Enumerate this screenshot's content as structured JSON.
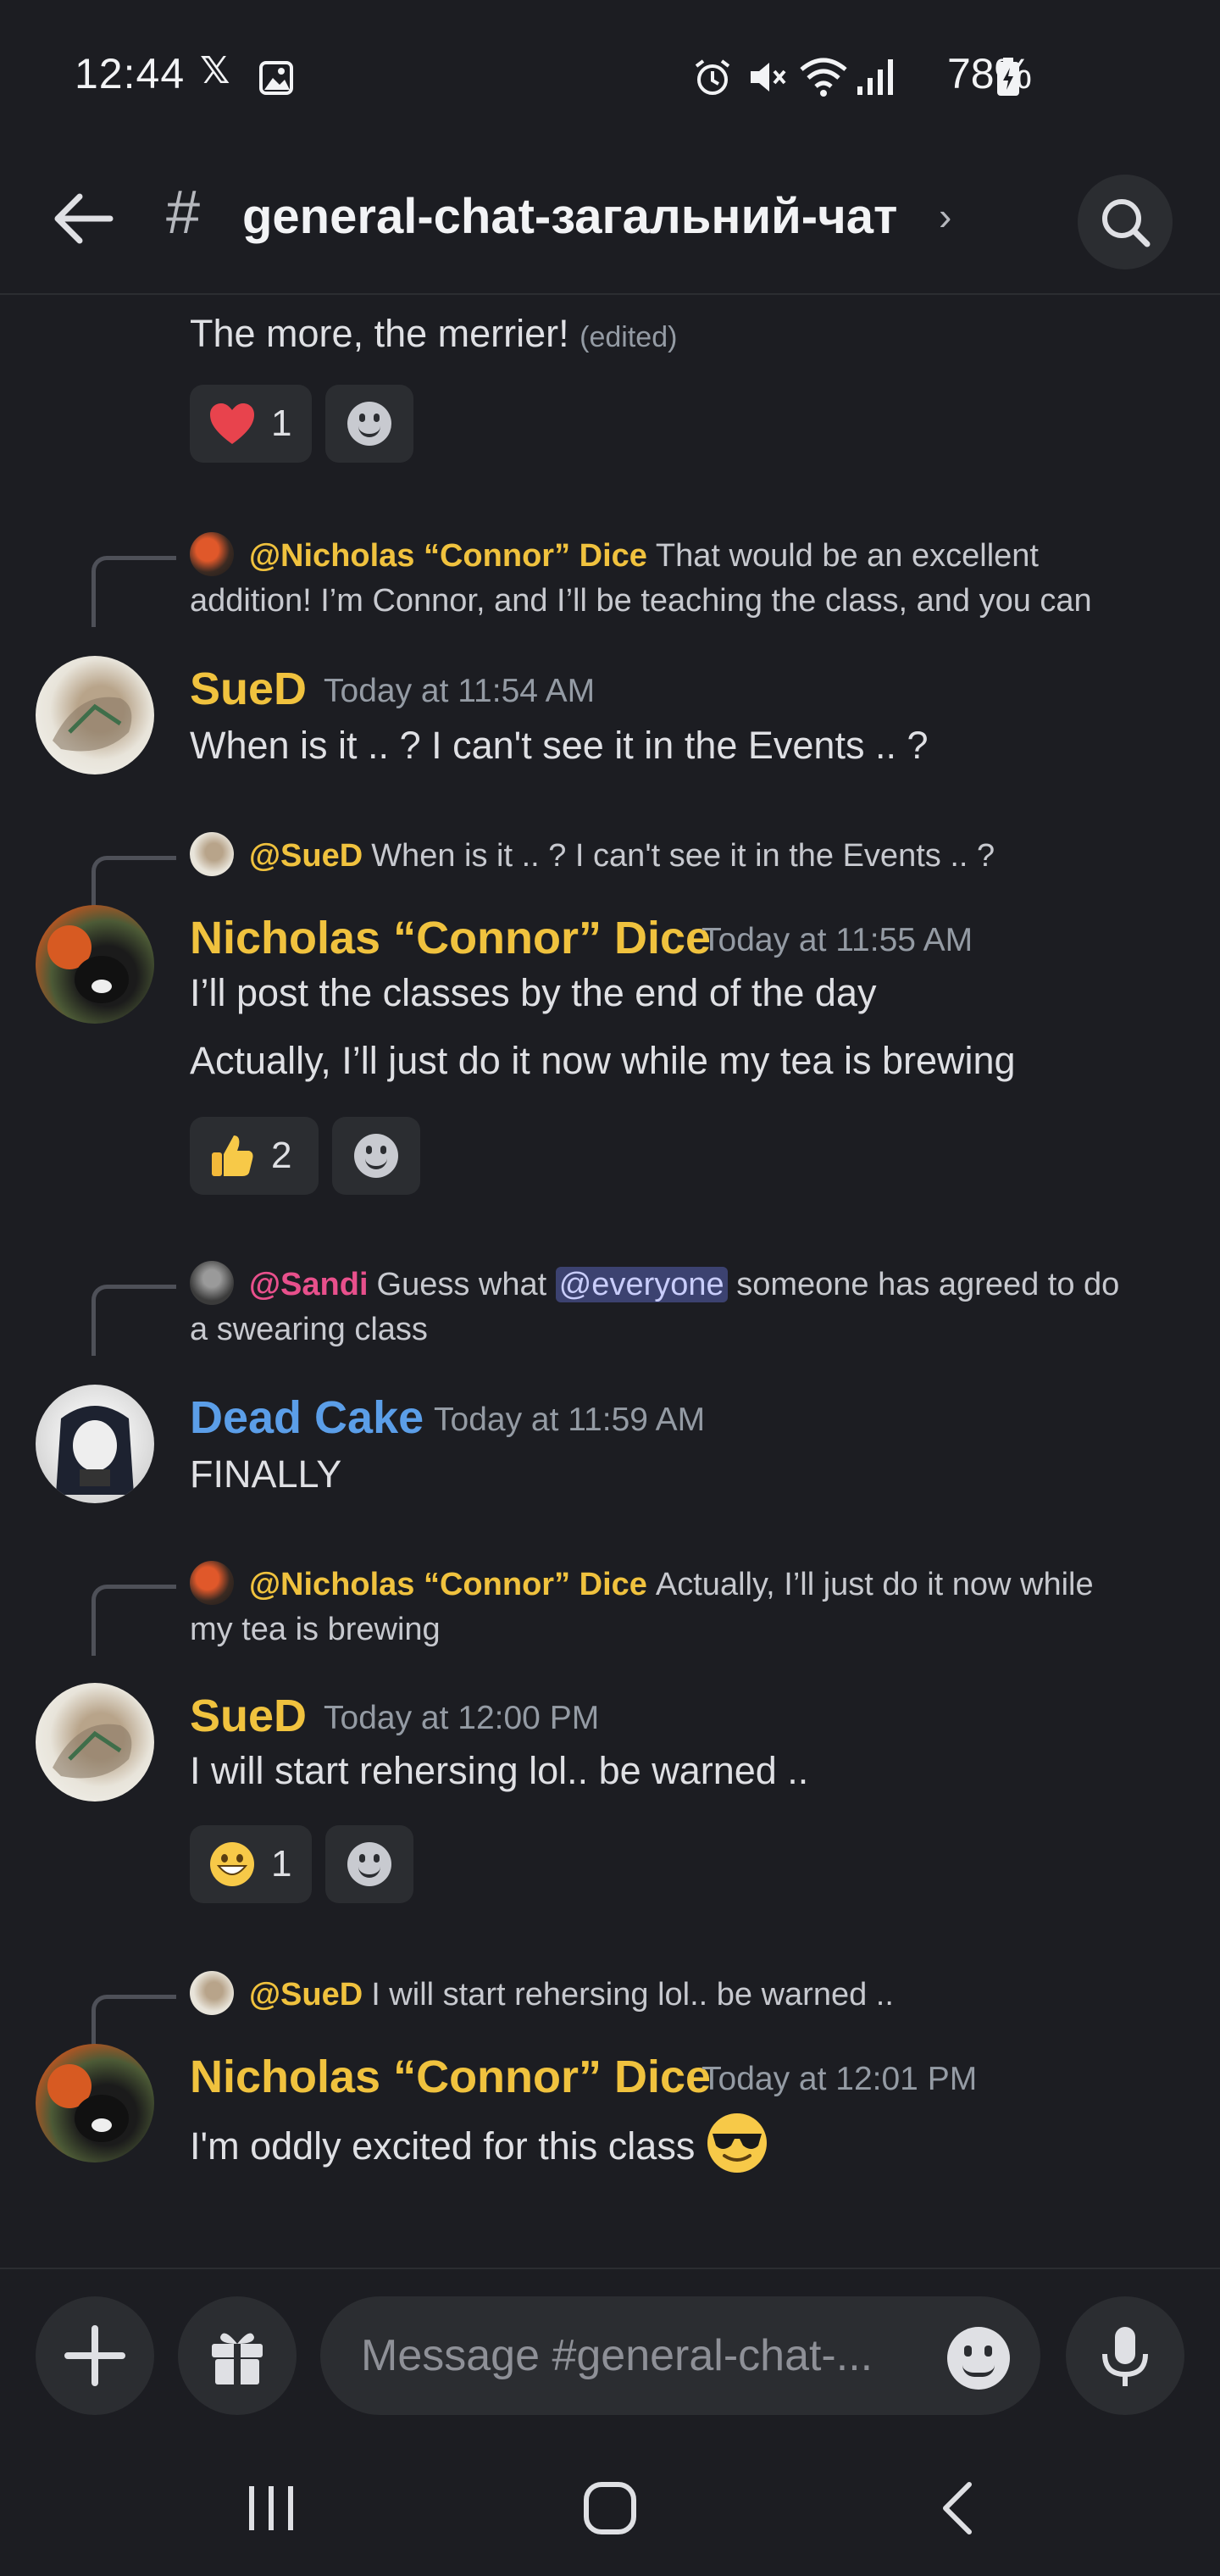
{
  "status_bar": {
    "time": "12:44",
    "battery": "78%"
  },
  "header": {
    "channel": "general-chat-загальний-чат"
  },
  "colors": {
    "sued": "#f0c23e",
    "connor": "#f0c23e",
    "deadcake": "#5b9ee8",
    "sandi": "#e8508c",
    "background": "#1c1d22"
  },
  "messages": {
    "m0": {
      "text": "The more, the merrier!",
      "edited": "(edited)",
      "reaction_count": "1",
      "reaction_emoji": "heart"
    },
    "m1": {
      "reply_name": "@Nicholas “Connor” Dice",
      "reply_text1": "That would be an excellent",
      "reply_text2": "addition! I’m Connor, and I’ll be teaching the class, and you can",
      "author": "SueD",
      "time": "Today at 11:54 AM",
      "text": "When is it .. ? I can't see it in the Events .. ?"
    },
    "m2": {
      "reply_name": "@SueD",
      "reply_text1": "When is it .. ? I can't see it in the Events .. ?",
      "author": "Nicholas “Connor” Dice",
      "time": "Today at 11:55 AM",
      "text1": "I’ll post the classes by the end of the day",
      "text2": "Actually, I’ll just do it now while my tea is brewing",
      "reaction_count": "2",
      "reaction_emoji": "thumbs-up"
    },
    "m3": {
      "reply_name": "@Sandi",
      "reply_text_pre": "Guess what",
      "reply_mention": "@everyone",
      "reply_text_post": "someone has agreed to do",
      "reply_text2": "a swearing class",
      "author": "Dead Cake",
      "time": "Today at 11:59 AM",
      "text": "FINALLY"
    },
    "m4": {
      "reply_name": "@Nicholas “Connor” Dice",
      "reply_text1": "Actually, I’ll just do it now while",
      "reply_text2": "my tea is brewing",
      "author": "SueD",
      "time": "Today at 12:00 PM",
      "text": "I will start rehersing lol.. be warned ..",
      "reaction_count": "1",
      "reaction_emoji": "grinning-face"
    },
    "m5": {
      "reply_name": "@SueD",
      "reply_text1": "I will start rehersing lol.. be warned ..",
      "author": "Nicholas “Connor” Dice",
      "time": "Today at 12:01 PM",
      "text": "I'm oddly excited for this class",
      "emoji": "smiling-face-with-sunglasses"
    }
  },
  "composer": {
    "placeholder": "Message #general-chat-..."
  }
}
